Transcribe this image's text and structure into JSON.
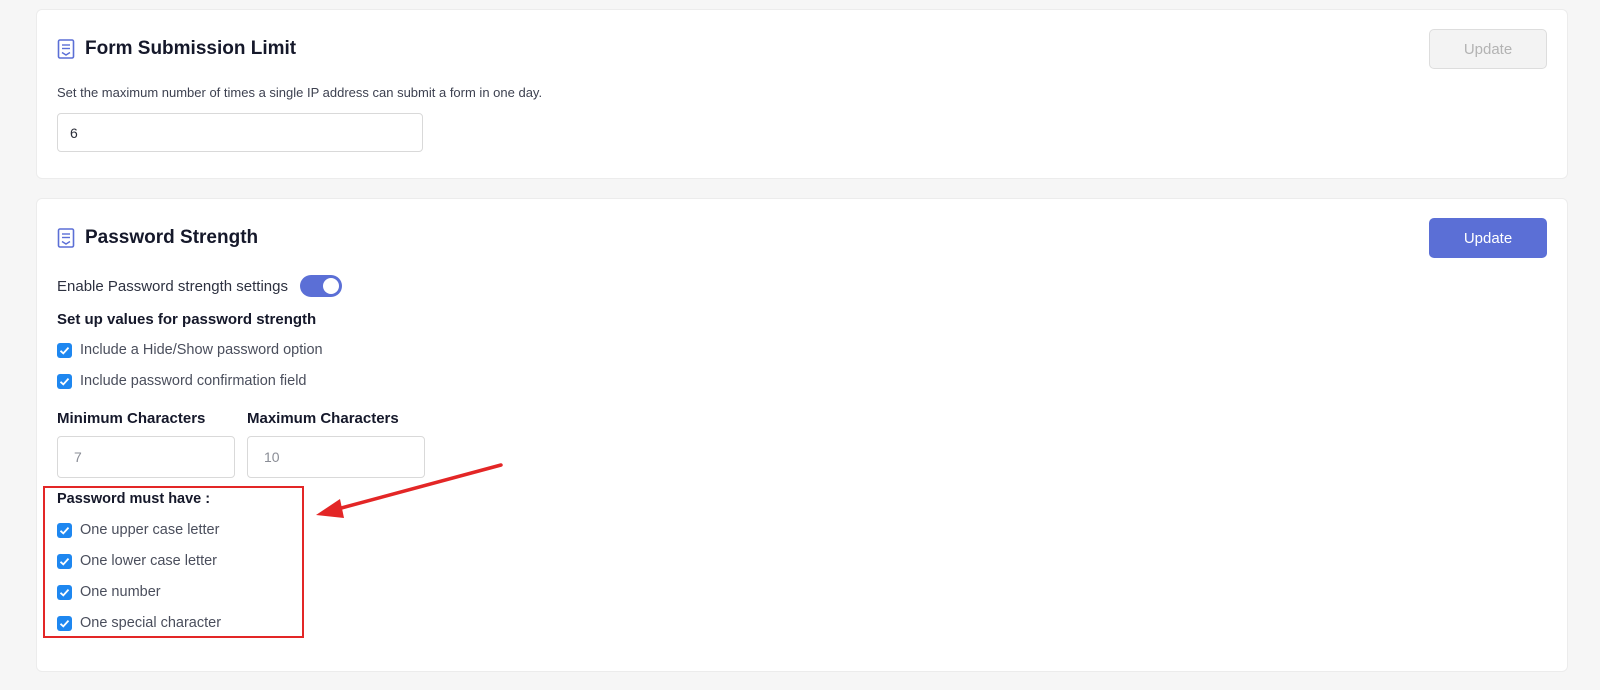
{
  "form_limit": {
    "title": "Form Submission Limit",
    "update_label": "Update",
    "description": "Set the maximum number of times a single IP address can submit a form in one day.",
    "value": "6"
  },
  "password_strength": {
    "title": "Password Strength",
    "update_label": "Update",
    "toggle_label": "Enable Password strength settings",
    "toggle_on": true,
    "setup_heading": "Set up values for password strength",
    "options": [
      {
        "label": "Include a Hide/Show password option",
        "checked": true
      },
      {
        "label": "Include password confirmation field",
        "checked": true
      }
    ],
    "min_label": "Minimum Characters",
    "min_value": "7",
    "max_label": "Maximum Characters",
    "max_value": "10",
    "must_have_heading": "Password must have :",
    "requirements": [
      {
        "label": "One upper case letter",
        "checked": true
      },
      {
        "label": "One lower case letter",
        "checked": true
      },
      {
        "label": "One number",
        "checked": true
      },
      {
        "label": "One special character",
        "checked": true
      }
    ]
  },
  "colors": {
    "primary": "#5b6fd6",
    "checkbox": "#1e87f0",
    "annotation": "#e32626"
  },
  "icons": [
    "document-icon",
    "check-icon",
    "arrow-annotation"
  ]
}
